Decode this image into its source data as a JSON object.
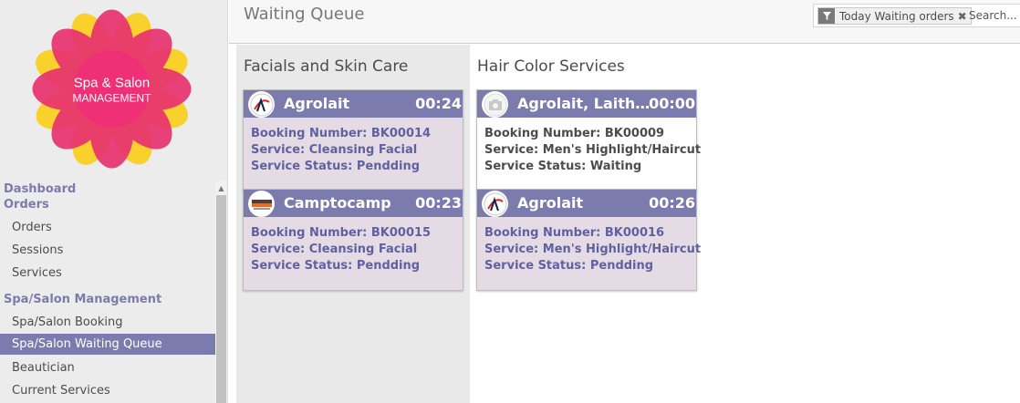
{
  "logo": {
    "line1": "Spa & Salon",
    "line2": "MANAGEMENT"
  },
  "menu": {
    "dashboard": "Dashboard",
    "orders_section": "Orders",
    "orders_items": [
      "Orders",
      "Sessions",
      "Services"
    ],
    "spa_section": "Spa/Salon Management",
    "spa_items": [
      "Spa/Salon Booking",
      "Spa/Salon Waiting Queue",
      "Beautician",
      "Current Services"
    ]
  },
  "control": {
    "title": "Waiting Queue",
    "facet_label": "Today Waiting orders",
    "search_placeholder": "Search..."
  },
  "columns": [
    {
      "title": "Facials and Skin Care",
      "cards": [
        {
          "name": "Agrolait",
          "time": "00:24",
          "avatar": "agrolait",
          "booking": "Booking Number: BK00014",
          "service": "Service: Cleansing Facial",
          "status": "Service Status: Pendding"
        },
        {
          "name": "Camptocamp",
          "time": "00:23",
          "avatar": "camptocamp",
          "booking": "Booking Number: BK00015",
          "service": "Service: Cleansing Facial",
          "status": "Service Status: Pendding"
        }
      ]
    },
    {
      "title": "Hair Color Services",
      "cards": [
        {
          "name": "Agrolait, Laith Ju...",
          "time": "00:00",
          "avatar": "camera",
          "booking": "Booking Number: BK00009",
          "service": "Service: Men's Highlight/Haircut",
          "status": "Service Status: Waiting"
        },
        {
          "name": "Agrolait",
          "time": "00:26",
          "avatar": "agrolait",
          "booking": "Booking Number: BK00016",
          "service": "Service: Men's Highlight/Haircut",
          "status": "Service Status: Pendding"
        }
      ]
    }
  ],
  "colors": {
    "accent": "#7c7bad",
    "card_bg": "#e5dbe5",
    "sidebar_bg": "#ececec"
  }
}
